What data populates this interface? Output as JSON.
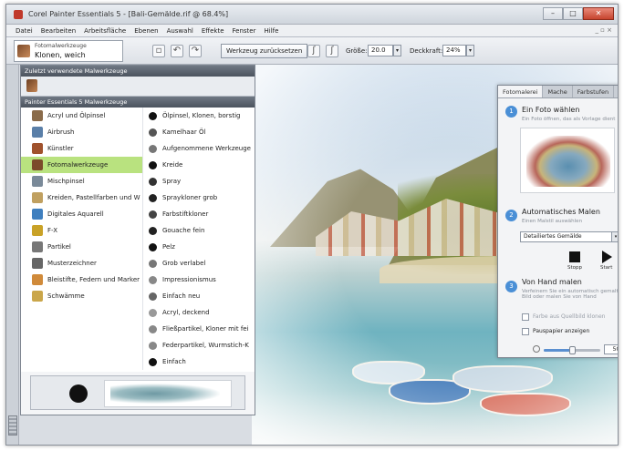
{
  "window": {
    "title": "Corel Painter Essentials 5 - [Bali-Gemälde.rif @ 68.4%]",
    "min": "–",
    "max": "□",
    "close": "✕"
  },
  "menubar": {
    "items": [
      "Datei",
      "Bearbeiten",
      "Arbeitsfläche",
      "Ebenen",
      "Auswahl",
      "Effekte",
      "Fenster",
      "Hilfe"
    ],
    "right": "_ ▫ ×"
  },
  "propbar": {
    "brush_small": "Fotomalwerkzeuge",
    "brush_name": "Klonen, weich",
    "reset": "Werkzeug zurücksetzen",
    "size_label": "Größe:",
    "size_value": "20.0",
    "opacity_label": "Deckkraft:",
    "opacity_value": "24%"
  },
  "brush_panel": {
    "recent_header": "Zuletzt verwendete Malwerkzeuge",
    "library_header": "Painter Essentials 5 Malwerkzeuge",
    "categories": [
      {
        "label": "Acryl und Ölpinsel",
        "icon": "acrylic-brush-icon",
        "color": "#8a6b4a"
      },
      {
        "label": "Airbrush",
        "icon": "airbrush-icon",
        "color": "#5a7fa8"
      },
      {
        "label": "Künstler",
        "icon": "artist-brush-icon",
        "color": "#a0522d"
      },
      {
        "label": "Fotomalwerkzeuge",
        "icon": "photo-paint-icon",
        "color": "#7b4a2a"
      },
      {
        "label": "Mischpinsel",
        "icon": "blender-brush-icon",
        "color": "#7a8a99"
      },
      {
        "label": "Kreiden, Pastellfarben und W",
        "icon": "chalk-icon",
        "color": "#c0a060"
      },
      {
        "label": "Digitales Aquarell",
        "icon": "watercolor-icon",
        "color": "#3f7fbf"
      },
      {
        "label": "F-X",
        "icon": "fx-icon",
        "color": "#c9a227"
      },
      {
        "label": "Partikel",
        "icon": "particle-icon",
        "color": "#777777"
      },
      {
        "label": "Musterzeichner",
        "icon": "pattern-pen-icon",
        "color": "#666666"
      },
      {
        "label": "Bleistifte, Federn und Marker",
        "icon": "pencil-icon",
        "color": "#d08a3a"
      },
      {
        "label": "Schwämme",
        "icon": "sponge-icon",
        "color": "#caa64a"
      }
    ],
    "selected_category": 3,
    "variants": [
      {
        "label": "Ölpinsel, Klonen, borstig",
        "color": "#111111"
      },
      {
        "label": "Kamelhaar Öl",
        "color": "#555555"
      },
      {
        "label": "Aufgenommene Werkzeuge",
        "color": "#777777"
      },
      {
        "label": "Kreide",
        "color": "#111111"
      },
      {
        "label": "Spray",
        "color": "#333333"
      },
      {
        "label": "Spraykloner grob",
        "color": "#222222"
      },
      {
        "label": "Farbstiftkloner",
        "color": "#444444"
      },
      {
        "label": "Gouache fein",
        "color": "#222222"
      },
      {
        "label": "Pelz",
        "color": "#111111"
      },
      {
        "label": "Grob verlabel",
        "color": "#777777"
      },
      {
        "label": "Impressionismus",
        "color": "#888888"
      },
      {
        "label": "Einfach neu",
        "color": "#666666"
      },
      {
        "label": "Acryl, deckend",
        "color": "#999999"
      },
      {
        "label": "Fließpartikel, Kloner mit fei",
        "color": "#888888"
      },
      {
        "label": "Federpartikel, Wurmstich-K",
        "color": "#888888"
      },
      {
        "label": "Einfach",
        "color": "#111111"
      }
    ]
  },
  "photo_panel": {
    "tabs": [
      "Fotomalerei",
      "Mache",
      "Farbstufen"
    ],
    "active_tab": 0,
    "step1_num": "1",
    "step1_title": "Ein Foto wählen",
    "step1_sub": "Ein Foto öffnen, das als Vorlage dient",
    "step2_num": "2",
    "step2_title": "Automatisches Malen",
    "step2_sub": "Einen Malstil auswählen",
    "style_value": "Detailiertes Gemälde",
    "stop_label": "Stopp",
    "start_label": "Start",
    "step3_num": "3",
    "step3_title": "Von Hand malen",
    "step3_sub": "Verfeinern Sie ein automatisch gemaltes Bild oder malen Sie von Hand",
    "checkbox1": "Farbe aus Quellbild klonen",
    "checkbox2": "Pauspapier anzeigen",
    "zoom_value": "50%",
    "zoom_fraction": 0.5
  }
}
